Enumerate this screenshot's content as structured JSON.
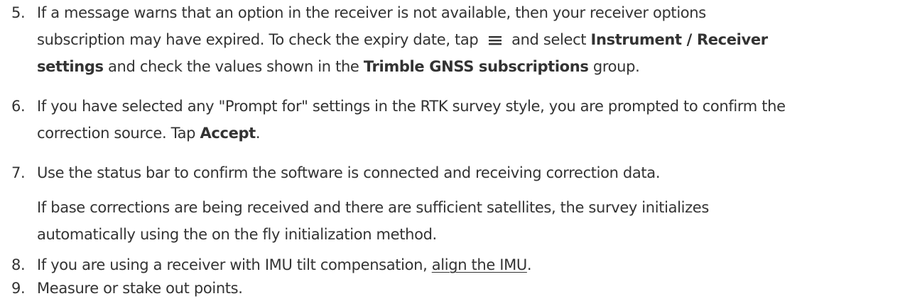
{
  "steps": [
    {
      "number": "5.",
      "line1": "If a message warns that an option in the receiver is not available, then your receiver options",
      "line2_before_icon": "subscription may have expired. To check the expiry date, tap",
      "line2_after_icon": "and select",
      "line2_bold": "Instrument / Receiver",
      "line3_bold_start": "settings",
      "line3_mid": "and check the values shown in the",
      "line3_bold": "Trimble GNSS subscriptions",
      "line3_end": "group.",
      "icon": "menu-icon"
    },
    {
      "number": "6.",
      "line1": "If you have selected any \"Prompt for\" settings in the RTK survey style, you are prompted to confirm the",
      "line2_before": "correction source. Tap",
      "line2_bold": "Accept",
      "line2_end": "."
    },
    {
      "number": "7.",
      "line1": "Use the status bar to confirm the software is connected and receiving correction data.",
      "note_line1": "If base corrections are being received and there are sufficient satellites, the survey initializes",
      "note_line2": "automatically using the on the fly initialization method."
    },
    {
      "number": "8.",
      "line1_before": "If you are using a receiver with IMU tilt compensation,",
      "link": "align the IMU",
      "line1_end": "."
    },
    {
      "number": "9.",
      "line1": "Measure or stake out points."
    }
  ]
}
